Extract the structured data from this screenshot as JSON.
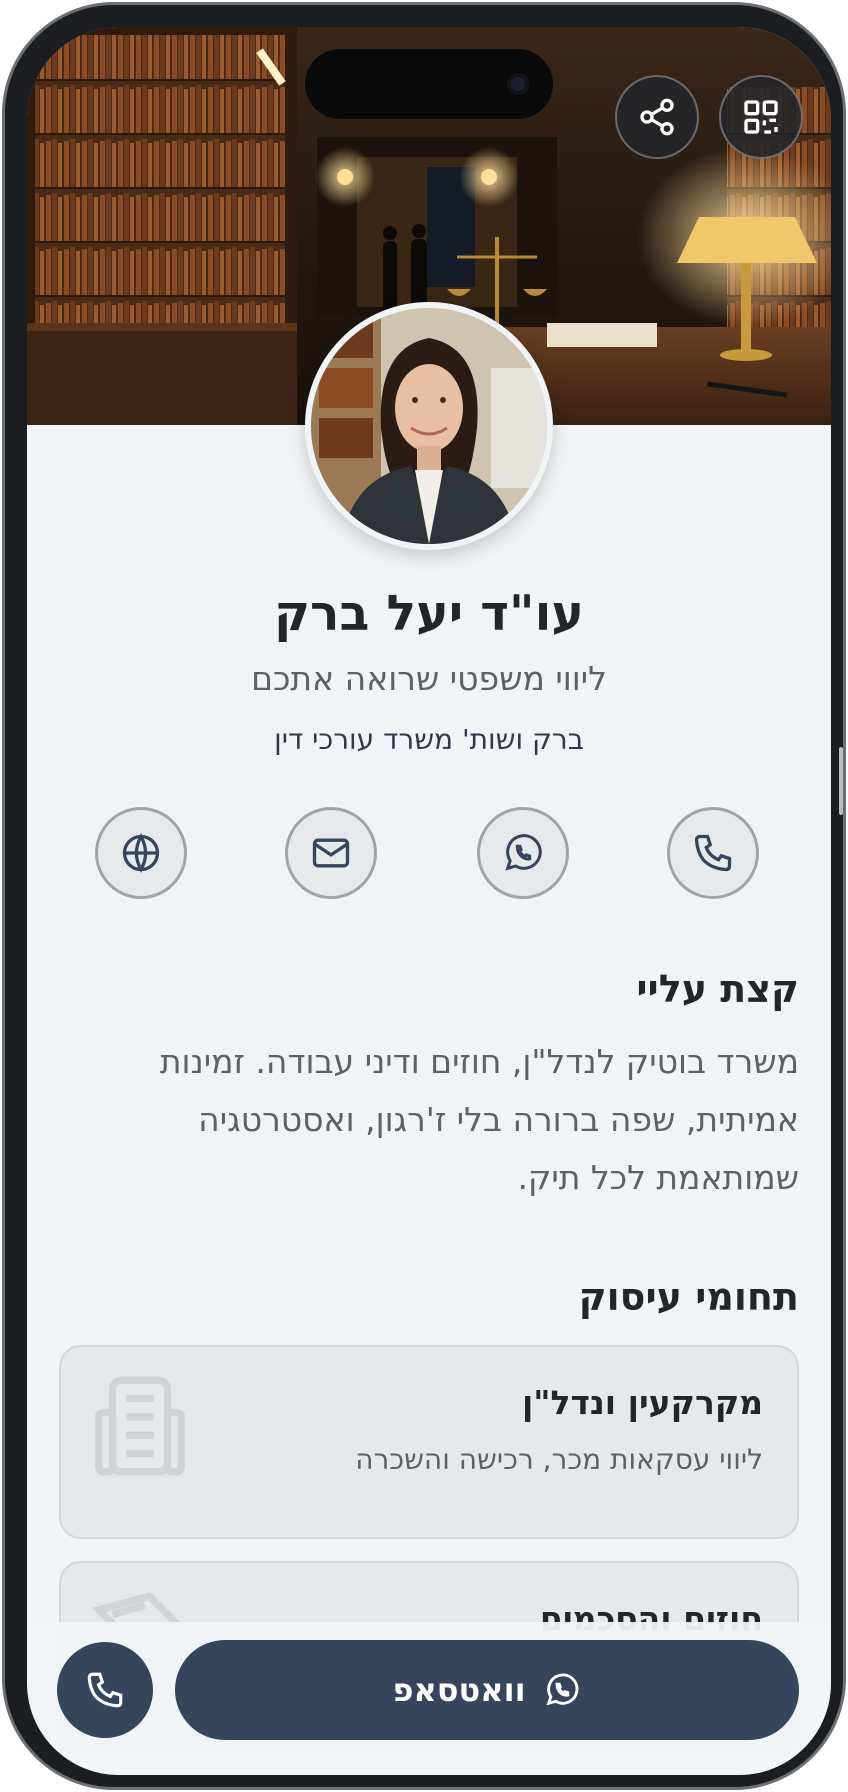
{
  "profile": {
    "name": "עו\"ד יעל ברק",
    "tagline": "ליווי משפטי שרואה אתכם",
    "firm": "ברק ושות' משרד עורכי דין"
  },
  "actions": {
    "qr_icon": "qr-code-icon",
    "share_icon": "share-icon"
  },
  "contacts": [
    {
      "icon": "phone-icon"
    },
    {
      "icon": "whatsapp-icon"
    },
    {
      "icon": "mail-icon"
    },
    {
      "icon": "globe-icon"
    }
  ],
  "about": {
    "title": "קצת עליי",
    "text": "משרד בוטיק לנדל\"ן, חוזים ודיני עבודה. זמינות אמיתית, שפה ברורה בלי ז'רגון, ואסטרטגיה שמותאמת לכל תיק."
  },
  "practice": {
    "title": "תחומי עיסוק",
    "items": [
      {
        "title": "מקרקעין ונדל\"ן",
        "subtitle": "ליווי עסקאות מכר, רכישה והשכרה",
        "icon": "building-icon"
      },
      {
        "title": "חוזים והסכמים",
        "subtitle": "",
        "icon": "document-pen-icon"
      }
    ]
  },
  "bottom_bar": {
    "whatsapp_label": "וואטסאפ"
  },
  "colors": {
    "primary": "#34455c",
    "background": "#f1f4f6",
    "text": "#22262b",
    "muted": "#5c6168"
  }
}
